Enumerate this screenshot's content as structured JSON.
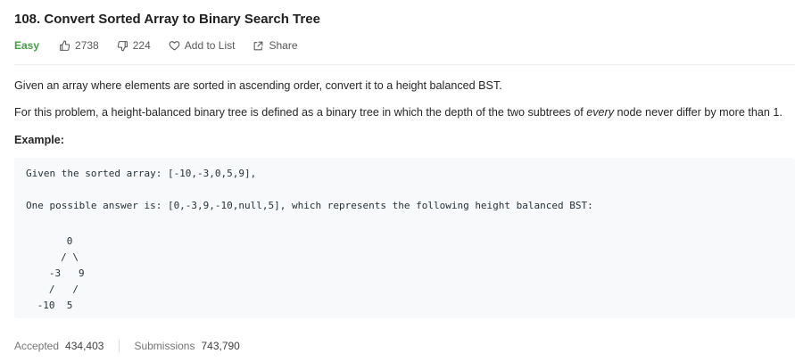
{
  "problem": {
    "title": "108. Convert Sorted Array to Binary Search Tree",
    "difficulty": "Easy",
    "likes": "2738",
    "dislikes": "224",
    "add_to_list_label": "Add to List",
    "share_label": "Share",
    "colors": {
      "difficulty": "#43a047",
      "code_background": "#f7f9fa"
    }
  },
  "description": {
    "paragraph1": "Given an array where elements are sorted in ascending order, convert it to a height balanced BST.",
    "paragraph2_before": "For this problem, a height-balanced binary tree is defined as a binary tree in which the depth of the two subtrees of ",
    "paragraph2_emphasis": "every",
    "paragraph2_after": " node never differ by more than 1.",
    "example_heading": "Example:"
  },
  "example": {
    "line1": "Given the sorted array: [-10,-3,0,5,9],",
    "line2": "One possible answer is: [0,-3,9,-10,null,5], which represents the following height balanced BST:",
    "tree": "      0\n     / \\\n   -3   9\n   /   /\n -10  5"
  },
  "stats": {
    "accepted_label": "Accepted",
    "accepted_value": "434,403",
    "submissions_label": "Submissions",
    "submissions_value": "743,790"
  }
}
